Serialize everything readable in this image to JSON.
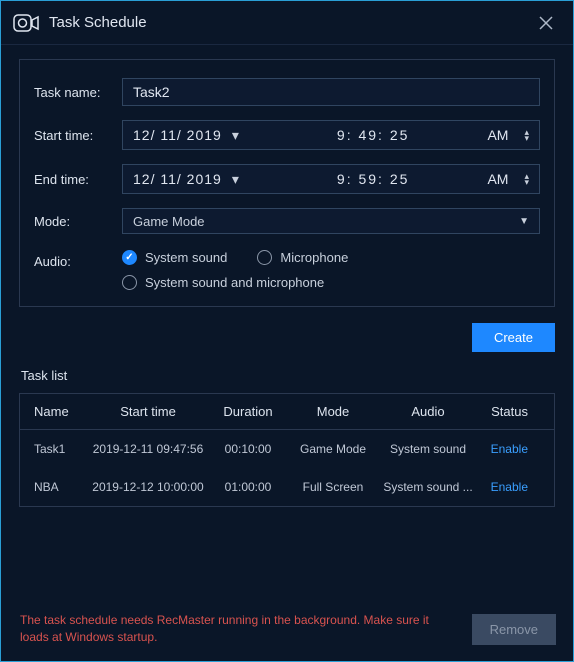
{
  "titlebar": {
    "title": "Task Schedule"
  },
  "form": {
    "taskname_label": "Task name:",
    "taskname_value": "Task2",
    "starttime_label": "Start time:",
    "start_date": "12/ 11/ 2019",
    "start_time": "9: 49: 25",
    "start_ampm": "AM",
    "endtime_label": "End time:",
    "end_date": "12/ 11/ 2019",
    "end_time": "9: 59: 25",
    "end_ampm": "AM",
    "mode_label": "Mode:",
    "mode_value": "Game Mode",
    "audio_label": "Audio:",
    "audio_opt1": "System sound",
    "audio_opt2": "Microphone",
    "audio_opt3": "System sound and microphone",
    "audio_selected": "System sound"
  },
  "actions": {
    "create": "Create",
    "remove": "Remove"
  },
  "tasklist": {
    "label": "Task list",
    "headers": {
      "name": "Name",
      "start": "Start time",
      "duration": "Duration",
      "mode": "Mode",
      "audio": "Audio",
      "status": "Status"
    },
    "rows": [
      {
        "name": "Task1",
        "start": "2019-12-11 09:47:56",
        "duration": "00:10:00",
        "mode": "Game Mode",
        "audio": "System sound",
        "status": "Enable"
      },
      {
        "name": "NBA",
        "start": "2019-12-12 10:00:00",
        "duration": "01:00:00",
        "mode": "Full Screen",
        "audio": "System sound ...",
        "status": "Enable"
      }
    ]
  },
  "footer": {
    "warning": "The task schedule needs RecMaster running in the background. Make sure it loads at Windows startup."
  }
}
